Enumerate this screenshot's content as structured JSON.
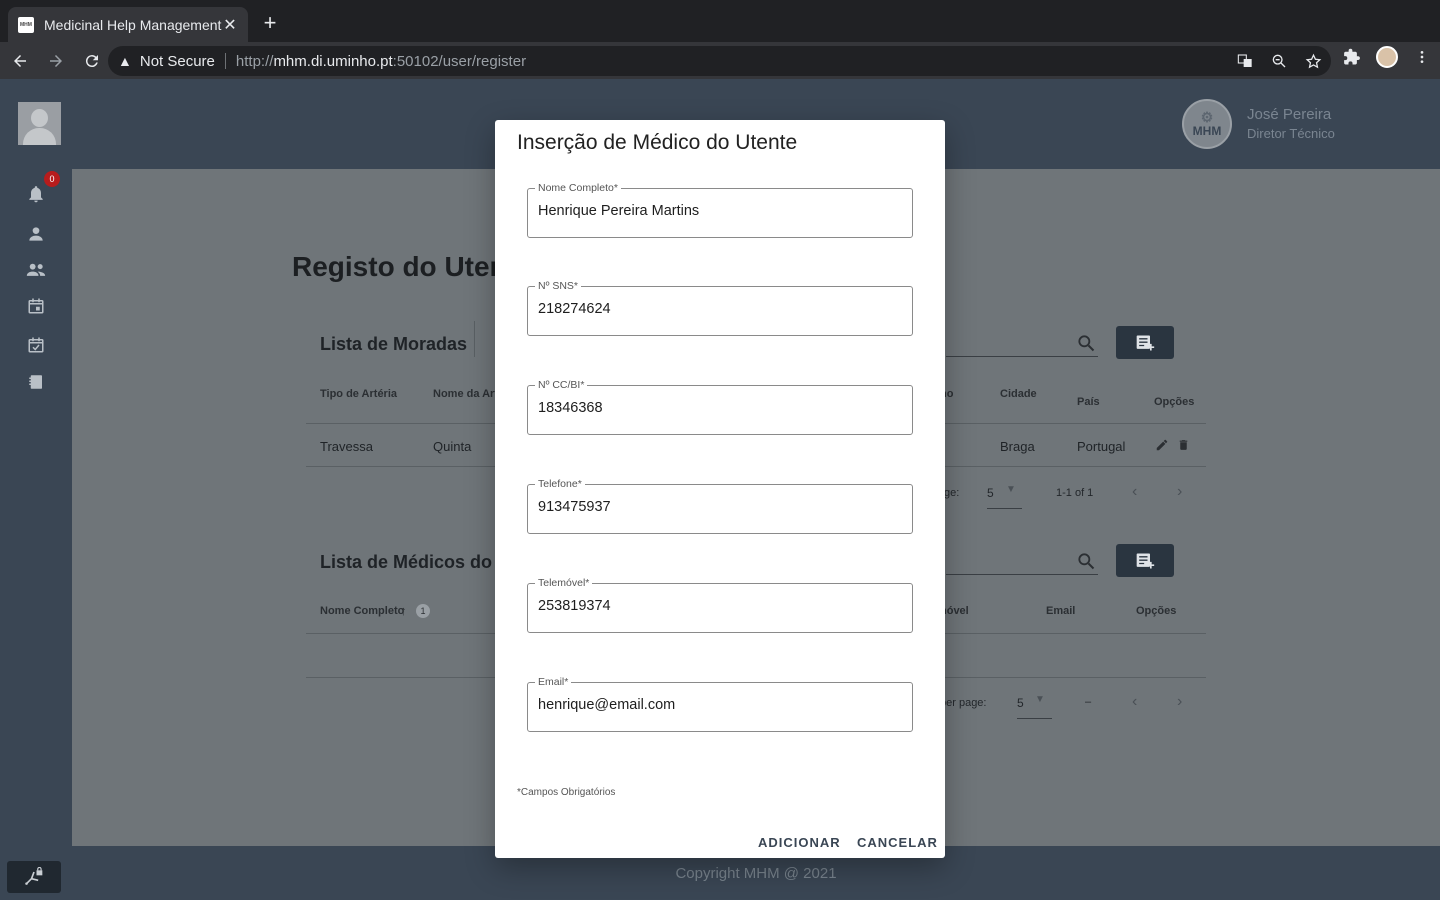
{
  "browser": {
    "tab_title": "Medicinal Help Management",
    "favicon_text": "MHM",
    "security_label": "Not Secure",
    "url_prefix": "http://",
    "url_host": "mhm.di.uminho.pt",
    "url_path": ":50102/user/register"
  },
  "header": {
    "user_name": "José Pereira",
    "user_role": "Diretor Técnico",
    "logo_text": "MHM"
  },
  "sidebar": {
    "notification_count": "0",
    "items": [
      "bell-icon",
      "person-icon",
      "people-icon",
      "calendar-icon",
      "event-check-icon",
      "book-icon"
    ]
  },
  "page": {
    "title": "Registo do Uten",
    "addresses": {
      "title": "Lista de Moradas",
      "columns": [
        "Tipo de Artéria",
        "Nome da Art",
        "ho",
        "Cidade",
        "País",
        "Opções"
      ],
      "row": [
        "Travessa",
        "Quinta",
        "Braga",
        "Portugal"
      ],
      "per_page_label": "ge:",
      "per_page_value": "5",
      "range": "1-1 of 1"
    },
    "doctors": {
      "title": "Lista de Médicos do U",
      "columns": [
        "Nome Completo",
        "nóvel",
        "Email",
        "Opções"
      ],
      "sort_badge": "1",
      "per_page_label": "per page:",
      "per_page_value": "5",
      "range": "–"
    }
  },
  "footer": {
    "copyright": "Copyright MHM @ 2021"
  },
  "dialog": {
    "title": "Inserção de Médico do Utente",
    "fields": [
      {
        "label": "Nome Completo*",
        "value": "Henrique Pereira Martins"
      },
      {
        "label": "Nº SNS*",
        "value": "218274624"
      },
      {
        "label": "Nº CC/BI*",
        "value": "18346368"
      },
      {
        "label": "Telefone*",
        "value": "913475937"
      },
      {
        "label": "Telemóvel*",
        "value": "253819374"
      },
      {
        "label": "Email*",
        "value": "henrique@email.com"
      }
    ],
    "required_note": "*Campos Obrigatórios",
    "add_label": "ADICIONAR",
    "cancel_label": "CANCELAR"
  }
}
